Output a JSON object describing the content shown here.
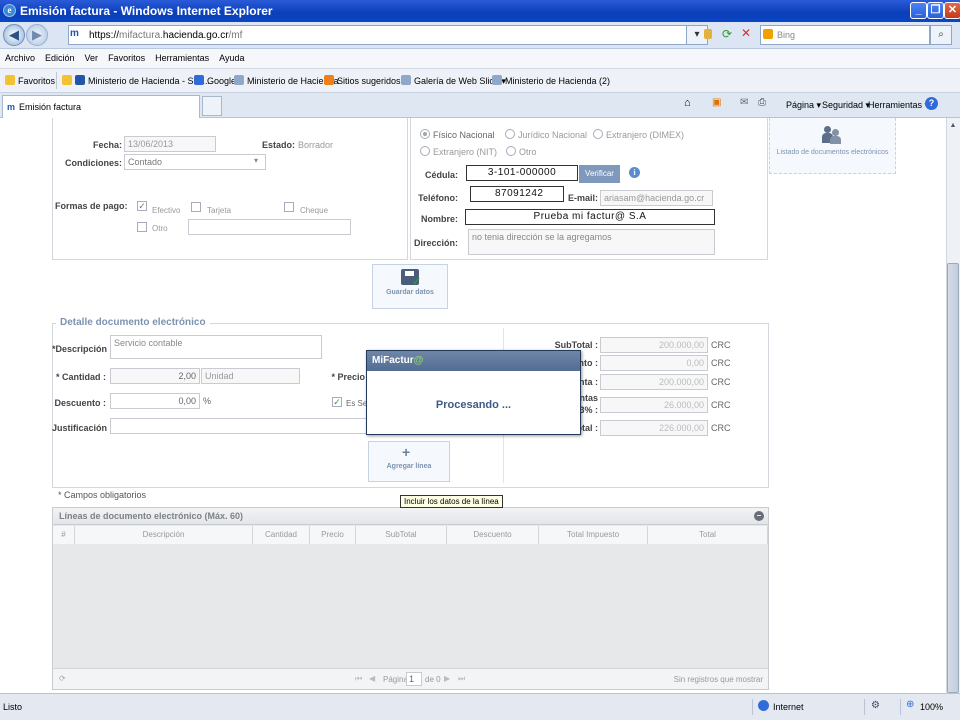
{
  "window": {
    "title": "Emisión factura - Windows Internet Explorer"
  },
  "address": {
    "url_prefix": "https://",
    "url_gray1": "mifactura.",
    "url_domain": "hacienda.go.cr",
    "url_gray2": "/mf",
    "search_placeholder": "Bing"
  },
  "menu": [
    "Archivo",
    "Edición",
    "Ver",
    "Favoritos",
    "Herramientas",
    "Ayuda"
  ],
  "favorites": {
    "label": "Favoritos",
    "items": [
      "Ministerio de Hacienda - Sist...",
      "Google",
      "Ministerio de Hacienda",
      "Sitios sugeridos ▾",
      "Galería de Web Slice ▾",
      "Ministerio de Hacienda (2)"
    ]
  },
  "tab": {
    "label": "Emisión factura"
  },
  "toolbar": {
    "page": "Página ▾",
    "security": "Seguridad ▾",
    "tools": "Herramientas ▾"
  },
  "form": {
    "fecha_label": "Fecha:",
    "fecha_value": "13/06/2013",
    "estado_label": "Estado:",
    "estado_value": "Borrador",
    "condiciones_label": "Condiciones:",
    "condiciones_value": "Contado",
    "formas_label": "Formas de pago:",
    "efectivo": "Efectivo",
    "tarjeta": "Tarjeta",
    "cheque": "Cheque",
    "otro": "Otro"
  },
  "client": {
    "radio_fisico": "Físico Nacional",
    "radio_juridico": "Jurídico Nacional",
    "radio_extranjero_dimex": "Extranjero (DIMEX)",
    "radio_extranjero_nit": "Extranjero (NIT)",
    "radio_otro": "Otro",
    "cedula_label": "Cédula:",
    "cedula_value": "3-101-000000",
    "verificar": "Verificar",
    "telefono_label": "Teléfono:",
    "telefono_value": "87091242",
    "email_label": "E-mail:",
    "email_value": "ariasam@hacienda.go.cr",
    "nombre_label": "Nombre:",
    "nombre_value": "Prueba mi factur@ S.A",
    "direccion_label": "Dirección:",
    "direccion_value": "no tenia dirección se la agregamos"
  },
  "side": {
    "listado": "Listado de documentos electrónicos"
  },
  "guardar": "Guardar datos",
  "detalle": {
    "title": "Detalle documento electrónico",
    "descripcion_label": "*Descripción :",
    "descripcion_value": "Servicio contable",
    "cantidad_label": "* Cantidad :",
    "cantidad_value": "2,00",
    "unidad_value": "Unidad",
    "precio_label": "* Precio",
    "descuento_label": "Descuento :",
    "descuento_value": "0,00",
    "pct": "%",
    "es_label": "Es Se",
    "justificacion_label": "Justificación :",
    "subtotal_label": "SubTotal :",
    "subtotal_value": "200.000,00",
    "r2_label": "ento :",
    "r2_value": "0,00",
    "r3_label": "enta :",
    "r3_value": "200.000,00",
    "r4_label_a": "entas",
    "r4_label_b": "13% :",
    "r4_value": "26.000,00",
    "r5_label": "otal :",
    "r5_value": "226.000,00",
    "currency": "CRC",
    "agregar": "Agregar línea",
    "tooltip": "Incluir los datos de la línea",
    "obligatorios": "* Campos obligatorios"
  },
  "grid": {
    "title": "Líneas de documento electrónico (Máx. 60)",
    "columns": [
      "#",
      "Descripción",
      "Cantidad",
      "Precio",
      "SubTotal",
      "Descuento",
      "Total Impuesto",
      "Total"
    ],
    "page_label": "Página",
    "page_value": "1",
    "of_label": "de 0",
    "no_records": "Sin registros que mostrar"
  },
  "dialog": {
    "title_a": "MiFactur",
    "title_b": "@",
    "message": "Procesando ..."
  },
  "status": {
    "left": "Listo",
    "zone": "Internet",
    "zoom": "100%"
  },
  "colors": {
    "titlebar": "#0a3fb8",
    "dialog_header": "#536c92",
    "processing_text": "#3f5a86"
  }
}
